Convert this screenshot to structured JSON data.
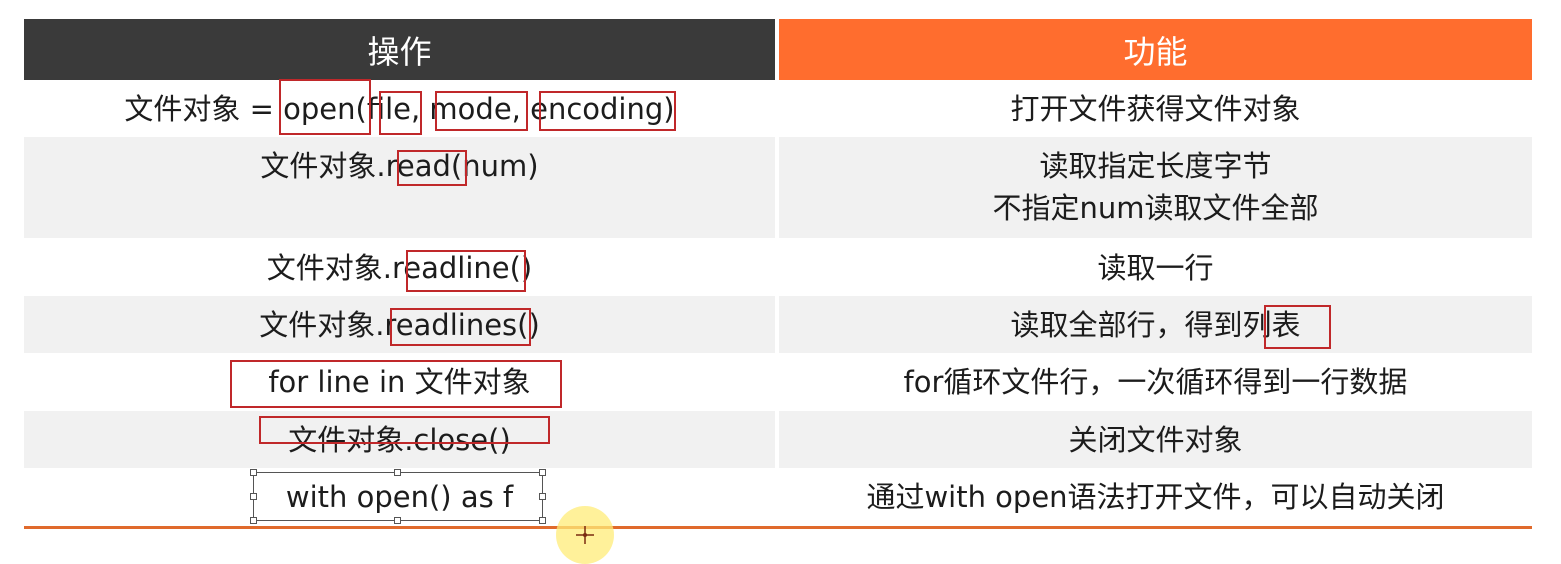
{
  "header": {
    "operation": "操作",
    "function": "功能"
  },
  "rows": [
    {
      "operation": "文件对象 = open(file, mode, encoding)",
      "function": [
        "打开文件获得文件对象"
      ]
    },
    {
      "operation": "文件对象.read(num)",
      "function": [
        "读取指定长度字节",
        "不指定num读取文件全部"
      ]
    },
    {
      "operation": "文件对象.readline()",
      "function": [
        "读取一行"
      ]
    },
    {
      "operation": "文件对象.readlines()",
      "function": [
        "读取全部行，得到列表"
      ]
    },
    {
      "operation": "for line in 文件对象",
      "function": [
        "for循环文件行，一次循环得到一行数据"
      ]
    },
    {
      "operation": "文件对象.close()",
      "function": [
        "关闭文件对象"
      ]
    },
    {
      "operation": "with open() as f",
      "function": [
        "通过with open语法打开文件，可以自动关闭"
      ]
    }
  ],
  "colors": {
    "header_operation": "#3a3a3a",
    "header_function": "#ff6d2e",
    "annotation": "#c0282a",
    "row_shade": "#f1f1f1",
    "bottom_rule": "#e06a2c"
  }
}
